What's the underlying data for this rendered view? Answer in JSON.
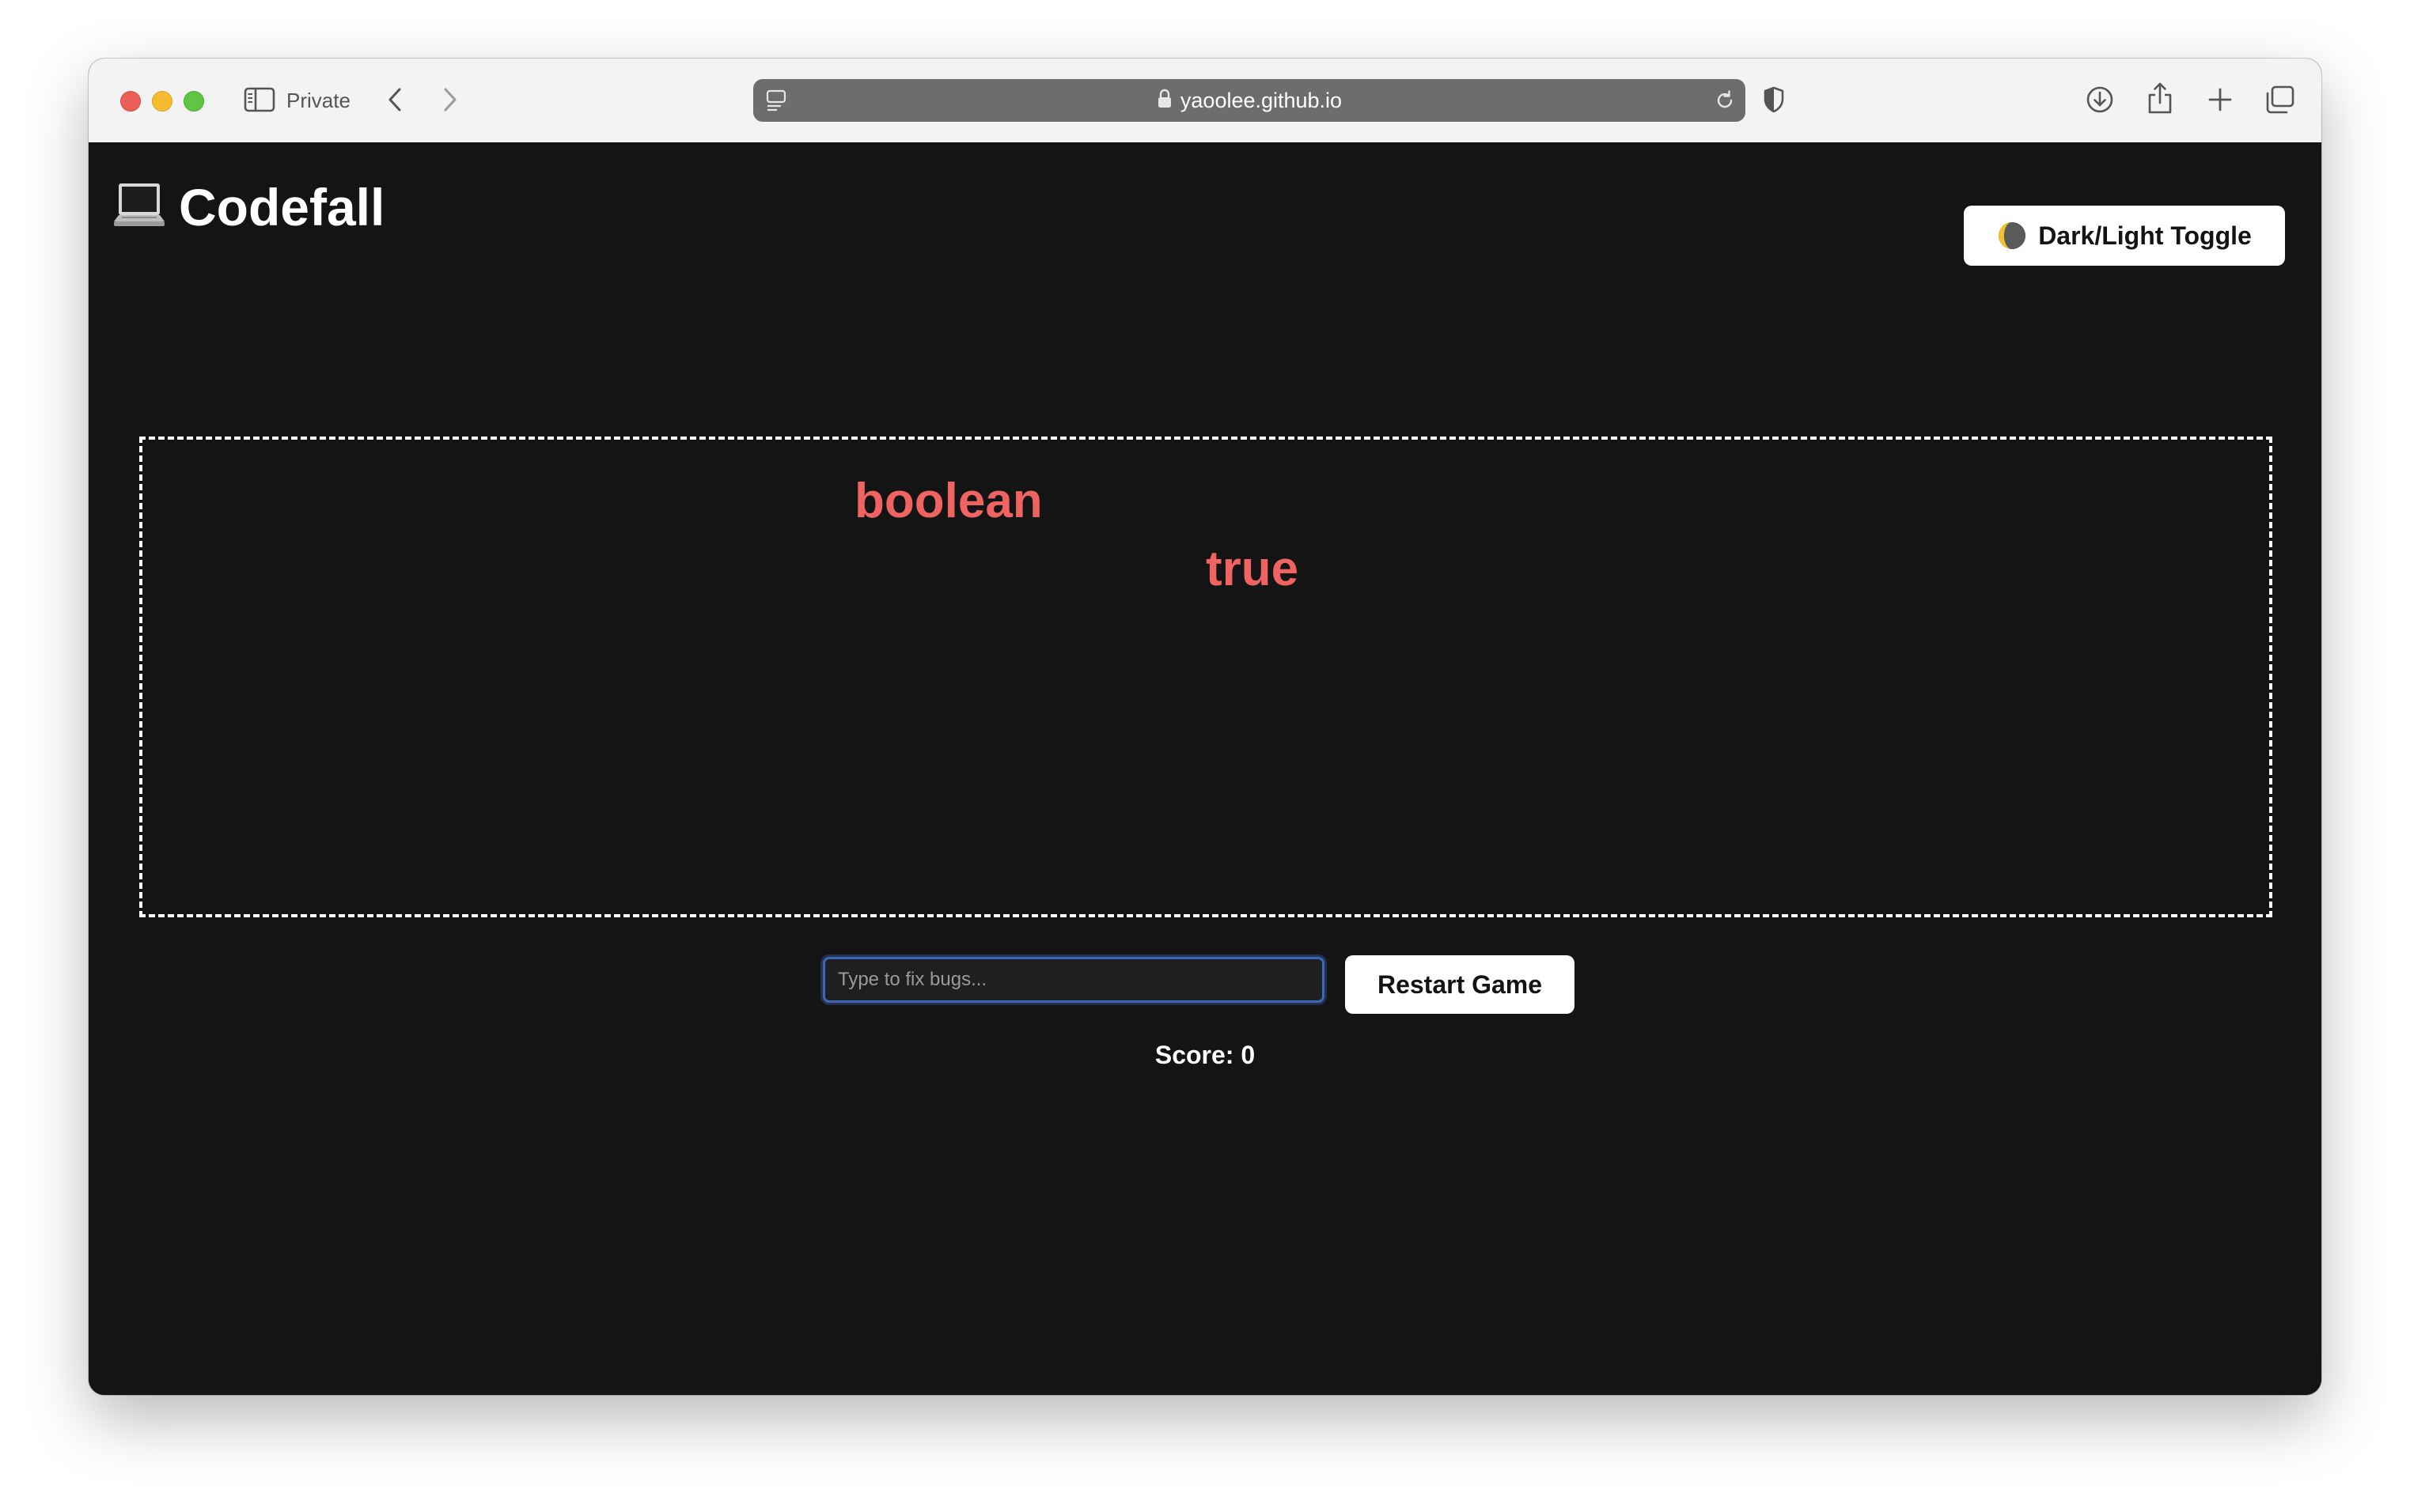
{
  "browser": {
    "private_label": "Private",
    "url": "yaoolee.github.io",
    "colors": {
      "toolbar_bg": "#f3f3f3",
      "address_bar_bg": "#6d6d6d",
      "traffic_red": "#ec5f57",
      "traffic_yellow": "#f4bd2f",
      "traffic_green": "#5fc542"
    },
    "icons": [
      "sidebar-toggle-icon",
      "back-chevron-icon",
      "forward-chevron-icon",
      "page-menu-icon",
      "lock-icon",
      "reload-icon",
      "shield-icon",
      "download-icon",
      "share-icon",
      "new-tab-plus-icon",
      "tab-overview-icon"
    ]
  },
  "page": {
    "title": "Codefall",
    "title_icon": "laptop-icon",
    "theme_toggle": {
      "label": "Dark/Light Toggle",
      "icon": "half-moon-icon"
    },
    "falling_words": [
      "boolean",
      "true"
    ],
    "input": {
      "placeholder": "Type to fix bugs...",
      "value": ""
    },
    "restart_label": "Restart Game",
    "score_text": "Score: 0",
    "colors": {
      "background": "#141414",
      "word_color": "#ef6461",
      "text_color": "#ffffff",
      "input_focus": "#3f67b9"
    }
  }
}
